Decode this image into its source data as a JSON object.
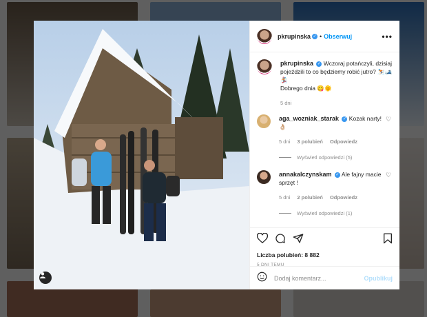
{
  "post": {
    "author": "pkrupinska",
    "follow_label": "Obserwuj",
    "dot": "•",
    "more_label": "•••",
    "caption_line1": "Wczoraj potańczyli, dzisiaj pojeździli to co będziemy robić jutro? ⛷️🎿🏂",
    "caption_line2": "Dobrego dnia 😋🌞",
    "caption_time": "5 dni"
  },
  "comments": [
    {
      "user": "aga_wozniak_starak",
      "text": "Kozak narty! 👌🏼",
      "time": "5 dni",
      "likes": "3 polubień",
      "reply": "Odpowiedz",
      "view_replies": "Wyświetl odpowiedzi (5)"
    },
    {
      "user": "annakalczynskam",
      "text": "Ale fajny macie sprzęt !",
      "time": "5 dni",
      "likes": "2 polubień",
      "reply": "Odpowiedz",
      "view_replies": "Wyświetl odpowiedzi (1)"
    }
  ],
  "actions": {
    "likes_label": "Liczba polubień: 8 882",
    "timestamp": "5 DNI TEMU",
    "comment_placeholder": "Dodaj komentarz...",
    "publish_label": "Opublikuj"
  },
  "colors": {
    "accent": "#0095f6",
    "verified": "#3897f0",
    "overlay": "rgba(0,0,0,0.62)"
  },
  "icons": [
    "heart-icon",
    "comment-icon",
    "share-icon",
    "bookmark-icon",
    "emoji-icon",
    "tag-user-icon",
    "verified-icon"
  ]
}
